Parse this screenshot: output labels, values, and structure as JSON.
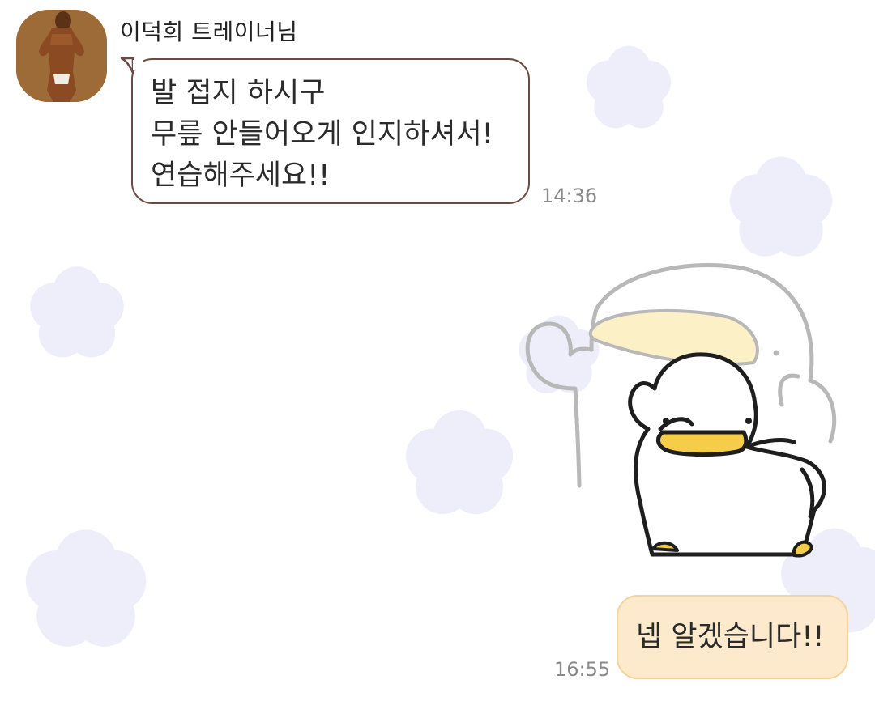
{
  "conversation": {
    "incoming": {
      "sender_name": "이덕희 트레이너님",
      "lines": [
        "발 접지 하시구",
        "무릎 안들어오게 인지하셔서!",
        "연습해주세요!!"
      ],
      "time": "14:36"
    },
    "outgoing": {
      "text": "넵 알겠습니다!!",
      "time": "16:55"
    }
  },
  "colors": {
    "incoming_border": "#6b4a44",
    "outgoing_bg": "#fdeacc",
    "outgoing_border": "#f3d39e",
    "background_flower": "#eeeefb",
    "duck_beak": "#f5cd4a"
  }
}
